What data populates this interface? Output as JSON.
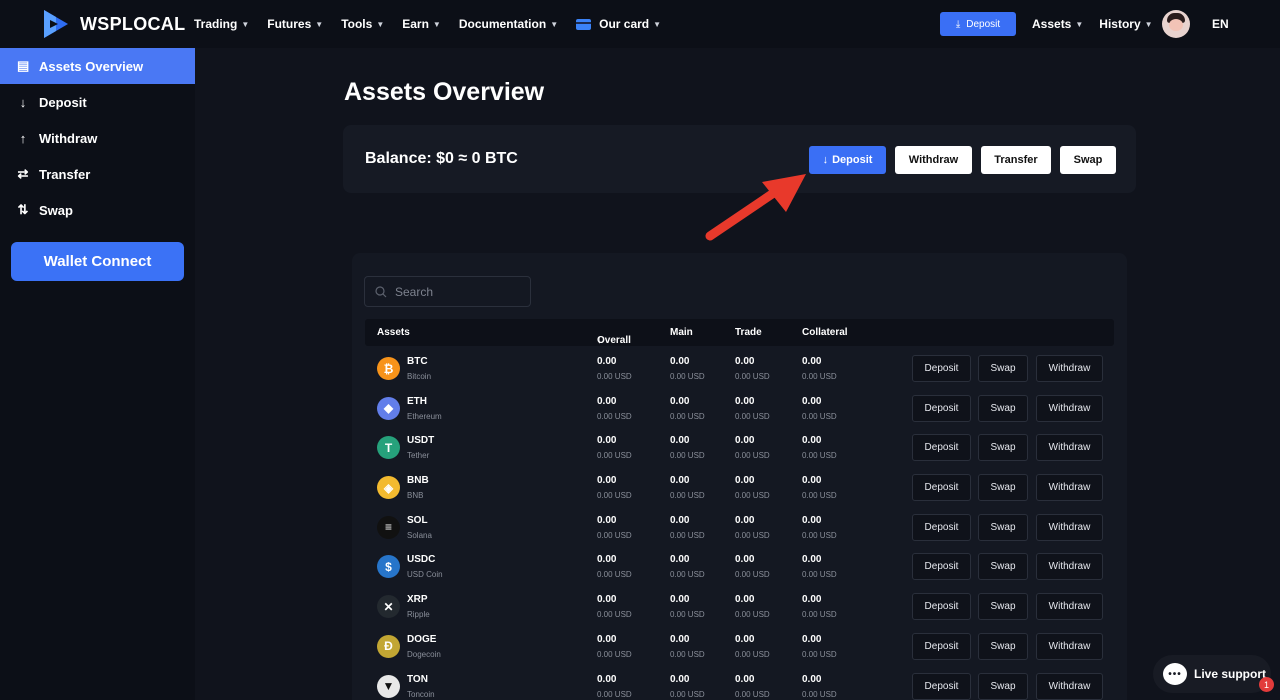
{
  "brand": {
    "name": "WSPLOCAL"
  },
  "nav": {
    "items": [
      {
        "label": "Trading"
      },
      {
        "label": "Futures"
      },
      {
        "label": "Tools"
      },
      {
        "label": "Earn"
      },
      {
        "label": "Documentation"
      },
      {
        "label": "Our card"
      }
    ],
    "deposit_label": "Deposit",
    "assets_label": "Assets",
    "history_label": "History",
    "lang": "EN"
  },
  "sidebar": {
    "items": [
      {
        "label": "Assets Overview",
        "icon": "wallet-icon"
      },
      {
        "label": "Deposit",
        "icon": "arrow-down-icon"
      },
      {
        "label": "Withdraw",
        "icon": "arrow-up-icon"
      },
      {
        "label": "Transfer",
        "icon": "transfer-icon"
      },
      {
        "label": "Swap",
        "icon": "swap-icon"
      }
    ],
    "wallet_connect": "Wallet Connect"
  },
  "page": {
    "title": "Assets Overview",
    "balance": "Balance: $0 ≈ 0 BTC",
    "buttons": {
      "deposit": "Deposit",
      "withdraw": "Withdraw",
      "transfer": "Transfer",
      "swap": "Swap"
    }
  },
  "table": {
    "search_placeholder": "Search",
    "headers": {
      "assets": "Assets",
      "overall": "Overall",
      "main": "Main",
      "trade": "Trade",
      "collateral": "Collateral"
    },
    "action_labels": {
      "deposit": "Deposit",
      "swap": "Swap",
      "withdraw": "Withdraw"
    },
    "rows": [
      {
        "symbol": "BTC",
        "name": "Bitcoin",
        "color": "#f7931a",
        "glyph": "₿",
        "overall": "0.00",
        "overall_usd": "0.00 USD",
        "main": "0.00",
        "main_usd": "0.00 USD",
        "trade": "0.00",
        "trade_usd": "0.00 USD",
        "collateral": "0.00",
        "collateral_usd": "0.00 USD"
      },
      {
        "symbol": "ETH",
        "name": "Ethereum",
        "color": "#627eea",
        "glyph": "◆",
        "overall": "0.00",
        "overall_usd": "0.00 USD",
        "main": "0.00",
        "main_usd": "0.00 USD",
        "trade": "0.00",
        "trade_usd": "0.00 USD",
        "collateral": "0.00",
        "collateral_usd": "0.00 USD"
      },
      {
        "symbol": "USDT",
        "name": "Tether",
        "color": "#26a17b",
        "glyph": "T",
        "overall": "0.00",
        "overall_usd": "0.00 USD",
        "main": "0.00",
        "main_usd": "0.00 USD",
        "trade": "0.00",
        "trade_usd": "0.00 USD",
        "collateral": "0.00",
        "collateral_usd": "0.00 USD"
      },
      {
        "symbol": "BNB",
        "name": "BNB",
        "color": "#f3ba2f",
        "glyph": "◈",
        "overall": "0.00",
        "overall_usd": "0.00 USD",
        "main": "0.00",
        "main_usd": "0.00 USD",
        "trade": "0.00",
        "trade_usd": "0.00 USD",
        "collateral": "0.00",
        "collateral_usd": "0.00 USD"
      },
      {
        "symbol": "SOL",
        "name": "Solana",
        "color": "#111111",
        "glyph": "≡",
        "overall": "0.00",
        "overall_usd": "0.00 USD",
        "main": "0.00",
        "main_usd": "0.00 USD",
        "trade": "0.00",
        "trade_usd": "0.00 USD",
        "collateral": "0.00",
        "collateral_usd": "0.00 USD"
      },
      {
        "symbol": "USDC",
        "name": "USD Coin",
        "color": "#2775ca",
        "glyph": "$",
        "overall": "0.00",
        "overall_usd": "0.00 USD",
        "main": "0.00",
        "main_usd": "0.00 USD",
        "trade": "0.00",
        "trade_usd": "0.00 USD",
        "collateral": "0.00",
        "collateral_usd": "0.00 USD"
      },
      {
        "symbol": "XRP",
        "name": "Ripple",
        "color": "#23292f",
        "glyph": "✕",
        "overall": "0.00",
        "overall_usd": "0.00 USD",
        "main": "0.00",
        "main_usd": "0.00 USD",
        "trade": "0.00",
        "trade_usd": "0.00 USD",
        "collateral": "0.00",
        "collateral_usd": "0.00 USD"
      },
      {
        "symbol": "DOGE",
        "name": "Dogecoin",
        "color": "#c2a633",
        "glyph": "Ð",
        "overall": "0.00",
        "overall_usd": "0.00 USD",
        "main": "0.00",
        "main_usd": "0.00 USD",
        "trade": "0.00",
        "trade_usd": "0.00 USD",
        "collateral": "0.00",
        "collateral_usd": "0.00 USD"
      },
      {
        "symbol": "TON",
        "name": "Toncoin",
        "color": "#e8e8e8",
        "glyph": "▼",
        "overall": "0.00",
        "overall_usd": "0.00 USD",
        "main": "0.00",
        "main_usd": "0.00 USD",
        "trade": "0.00",
        "trade_usd": "0.00 USD",
        "collateral": "0.00",
        "collateral_usd": "0.00 USD"
      }
    ]
  },
  "support": {
    "label": "Live support",
    "badge": "1"
  },
  "colors": {
    "accent": "#3a6ff5",
    "sidebar_active": "#4a78f4",
    "arrow": "#e8392b"
  }
}
